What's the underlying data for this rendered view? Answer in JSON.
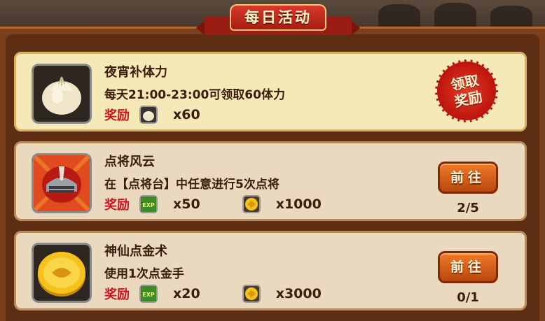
{
  "panel": {
    "title": "每日活动"
  },
  "activities": [
    {
      "name": "夜宵补体力",
      "description": "每天21:00-23:00可领取60体力",
      "reward_label": "奖励",
      "rewards": [
        {
          "icon": "bun-icon",
          "quantity": "x60"
        }
      ],
      "action": {
        "type": "claim",
        "label_line1": "领取",
        "label_line2": "奖励"
      }
    },
    {
      "name": "点将风云",
      "description": "在【点将台】中任意进行5次点将",
      "reward_label": "奖励",
      "rewards": [
        {
          "icon": "exp-icon",
          "quantity": "x50"
        },
        {
          "icon": "gold-coin-icon",
          "quantity": "x1000"
        }
      ],
      "action": {
        "type": "go",
        "label": "前往"
      },
      "progress": "2/5"
    },
    {
      "name": "神仙点金术",
      "description": "使用1次点金手",
      "reward_label": "奖励",
      "rewards": [
        {
          "icon": "exp-icon",
          "quantity": "x20"
        },
        {
          "icon": "gold-coin-icon",
          "quantity": "x3000"
        }
      ],
      "action": {
        "type": "go",
        "label": "前往"
      },
      "progress": "0/1"
    }
  ],
  "colors": {
    "frame": "#7a3f1c",
    "card": "#ead9bf",
    "card_highlight": "#f6e9b8",
    "reward_label": "#c7161b",
    "button": "#e06a20",
    "stamp": "#c0170f"
  }
}
